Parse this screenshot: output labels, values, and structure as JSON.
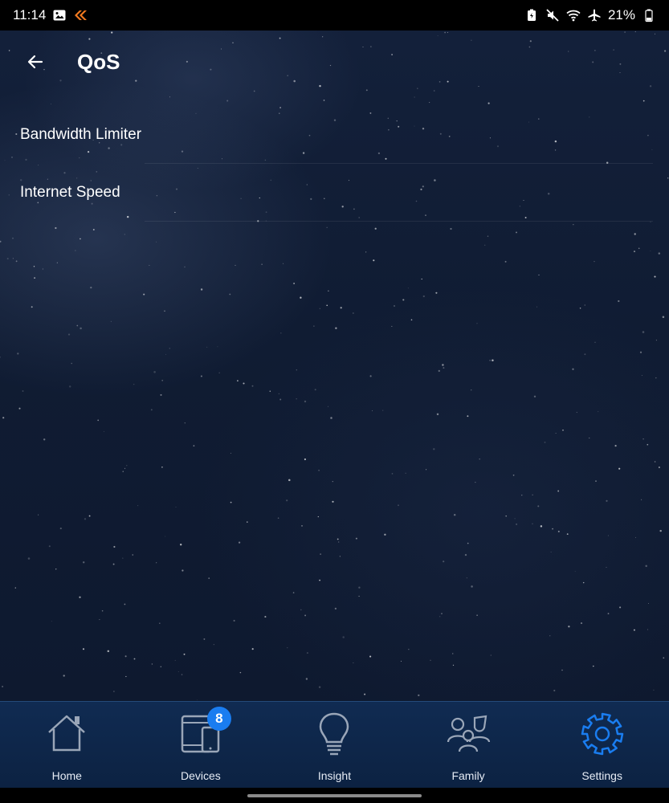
{
  "status_bar": {
    "time": "11:14",
    "battery_percent": "21%",
    "left_icons": [
      "image-icon",
      "app-notification-icon"
    ],
    "right_icons": [
      "battery-saver-icon",
      "mute-icon",
      "wifi-icon",
      "airplane-icon",
      "battery-icon"
    ]
  },
  "header": {
    "title": "QoS",
    "back_icon": "arrow-left-icon"
  },
  "menu": {
    "items": [
      {
        "label": "Bandwidth Limiter"
      },
      {
        "label": "Internet Speed"
      }
    ]
  },
  "bottom_nav": {
    "items": [
      {
        "label": "Home",
        "icon": "home-icon"
      },
      {
        "label": "Devices",
        "icon": "devices-icon",
        "badge": "8"
      },
      {
        "label": "Insight",
        "icon": "lightbulb-icon"
      },
      {
        "label": "Family",
        "icon": "family-icon"
      },
      {
        "label": "Settings",
        "icon": "gear-icon",
        "active": true
      }
    ]
  },
  "colors": {
    "background": "#101c33",
    "nav_background": "#102b52",
    "accent": "#1a7df0",
    "inactive_icon": "#9aa6b8"
  }
}
